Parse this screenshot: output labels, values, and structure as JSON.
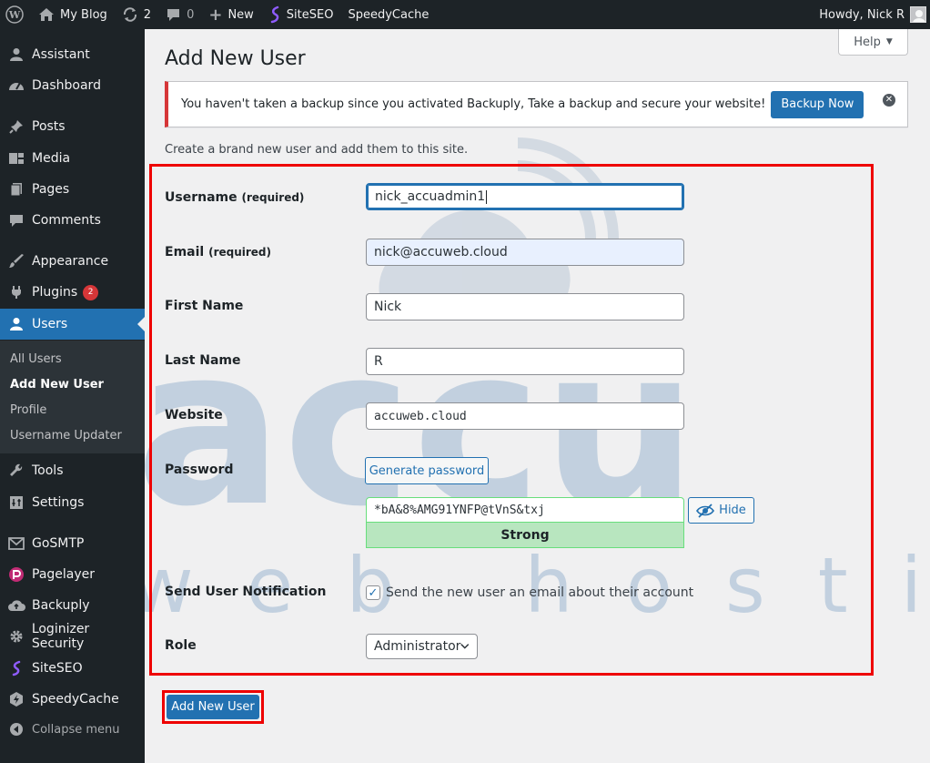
{
  "adminbar": {
    "site_name": "My Blog",
    "updates_count": "2",
    "comments_count": "0",
    "new_label": "New",
    "siteseo_label": "SiteSEO",
    "speedycache_label": "SpeedyCache",
    "greeting": "Howdy, Nick R"
  },
  "sidebar": {
    "items": [
      {
        "label": "Assistant",
        "icon": "person-icon"
      },
      {
        "label": "Dashboard",
        "icon": "dashboard-icon"
      },
      {
        "label": "Posts",
        "icon": "pin-icon"
      },
      {
        "label": "Media",
        "icon": "media-icon"
      },
      {
        "label": "Pages",
        "icon": "pages-icon"
      },
      {
        "label": "Comments",
        "icon": "comment-icon"
      },
      {
        "label": "Appearance",
        "icon": "brush-icon"
      },
      {
        "label": "Plugins",
        "icon": "plug-icon",
        "badge": "2"
      },
      {
        "label": "Users",
        "icon": "users-icon"
      },
      {
        "label": "Tools",
        "icon": "wrench-icon"
      },
      {
        "label": "Settings",
        "icon": "settings-icon"
      },
      {
        "label": "GoSMTP",
        "icon": "mail-icon"
      },
      {
        "label": "Pagelayer",
        "icon": "pagelayer-icon"
      },
      {
        "label": "Backuply",
        "icon": "cloud-upload-icon"
      },
      {
        "label": "Loginizer Security",
        "icon": "gear-icon"
      },
      {
        "label": "SiteSEO",
        "icon": "siteseo-icon"
      },
      {
        "label": "SpeedyCache",
        "icon": "speedycache-icon"
      },
      {
        "label": "Collapse menu",
        "icon": "collapse-icon"
      }
    ],
    "submenu": [
      "All Users",
      "Add New User",
      "Profile",
      "Username Updater"
    ]
  },
  "help_label": "Help",
  "page_title": "Add New User",
  "notice": {
    "text": "You haven't taken a backup since you activated Backuply, Take a backup and secure your website!",
    "button": "Backup Now"
  },
  "intro": "Create a brand new user and add them to this site.",
  "form": {
    "username_label": "Username",
    "username_req": "(required)",
    "username_value": "nick_accuadmin1",
    "email_label": "Email",
    "email_req": "(required)",
    "email_value": "nick@accuweb.cloud",
    "first_name_label": "First Name",
    "first_name_value": "Nick",
    "last_name_label": "Last Name",
    "last_name_value": "R",
    "website_label": "Website",
    "website_value": "accuweb.cloud",
    "password_label": "Password",
    "generate_label": "Generate password",
    "password_value": "*bA&8%AMG91YNFP@tVnS&txj",
    "hide_label": "Hide",
    "strength_label": "Strong",
    "notify_label": "Send User Notification",
    "notify_text": "Send the new user an email about their account",
    "notify_checked": true,
    "role_label": "Role",
    "role_value": "Administrator",
    "submit_label": "Add New User"
  },
  "watermark": {
    "line1": "accu",
    "line2": "web hosting"
  },
  "colors": {
    "accent": "#2271b1",
    "highlight_border": "#ee0000",
    "admin_dark": "#1d2327",
    "strength_bg": "#b8e6bf"
  }
}
